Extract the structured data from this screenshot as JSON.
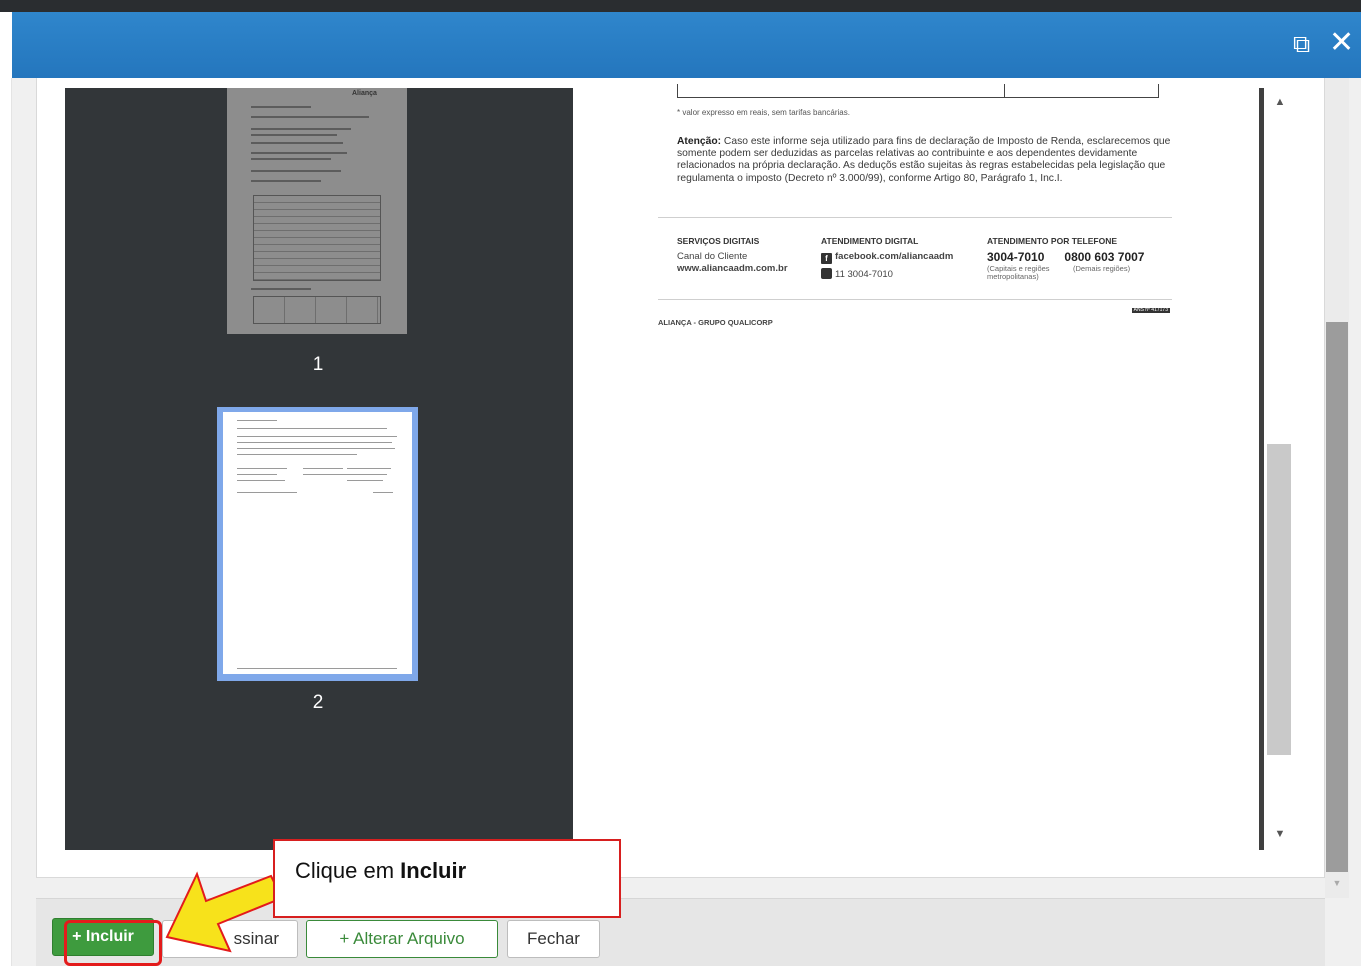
{
  "window": {
    "expand_icon": "external-link-icon",
    "close_icon": "close-icon",
    "expand_glyph": "⧉",
    "close_glyph": "✕",
    "accent": "#2f86cc"
  },
  "thumbnails": [
    {
      "page": "1",
      "brand": "Aliança",
      "selected": false
    },
    {
      "page": "2",
      "selected": true
    }
  ],
  "document": {
    "note": "* valor expresso em reais, sem tarifas bancárias.",
    "attention_label": "Atenção:",
    "attention_text": " Caso este informe seja utilizado para fins de declaração de Imposto de Renda, esclarecemos que somente podem ser deduzidas as parcelas relativas ao contribuinte e aos dependentes devidamente relacionados na própria declaração. As deduçõs estão sujeitas às regras estabelecidas pela legislação que regulamenta o imposto (Decreto nº 3.000/99), conforme Artigo 80, Parágrafo 1, Inc.I.",
    "services": {
      "heading": "SERVIÇOS DIGITAIS",
      "line1": "Canal do Cliente",
      "line2": "www.aliancaadm.com.br"
    },
    "digital": {
      "heading": "ATENDIMENTO DIGITAL",
      "facebook": "facebook.com/aliancaadm",
      "whatsapp": "11 3004-7010"
    },
    "phone": {
      "heading": "ATENDIMENTO POR TELEFONE",
      "number1": "3004-7010",
      "number2": "0800 603 7007",
      "caption1": "(Capitais e regiões metropolitanas)",
      "caption2": "(Demais regiões)"
    },
    "footer_brand": "ALIANÇA - GRUPO QUALICORP",
    "badge": "ANS nº 417173"
  },
  "toolbar": {
    "incluir": "+ Incluir",
    "assinar": "ssinar",
    "alterar": "+ Alterar Arquivo",
    "fechar": "Fechar"
  },
  "annotation": {
    "callout_prefix": "Clique em ",
    "callout_bold": "Incluir",
    "arrow_color": "#f7e21b",
    "box_color": "#e31b1b"
  }
}
